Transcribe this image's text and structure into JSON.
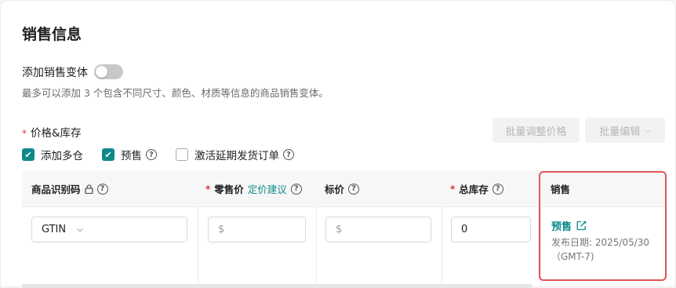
{
  "section": {
    "title": "销售信息",
    "variant_label": "添加销售变体",
    "variant_toggle_on": false,
    "variant_desc": "最多可以添加 3 个包含不同尺寸、颜色、材质等信息的商品销售变体。",
    "price_stock_required_mark": "*",
    "price_stock_label": "价格&库存"
  },
  "toolbar": {
    "batch_price_label": "批量调整价格",
    "batch_edit_label": "批量编辑"
  },
  "checkboxes": [
    {
      "label": "添加多仓",
      "checked": true
    },
    {
      "label": "预售",
      "checked": true
    },
    {
      "label": "激活延期发货订单",
      "checked": false
    }
  ],
  "table": {
    "headers": {
      "product_id": "商品识别码",
      "retail_price_req": "*",
      "retail_price": "零售价",
      "price_suggest": "定价建议",
      "list_price": "标价",
      "total_stock_req": "*",
      "total_stock": "总库存",
      "sales": "销售"
    },
    "row": {
      "id_type": "GTIN",
      "retail_prefix": "$",
      "list_prefix": "$",
      "stock_value": "0",
      "sale_link": "预售",
      "sale_info": "发布日期: 2025/05/30 （GMT-7)"
    }
  },
  "colors": {
    "accent": "#0f8a8a",
    "highlight": "#e05557",
    "required": "#e0343f"
  }
}
